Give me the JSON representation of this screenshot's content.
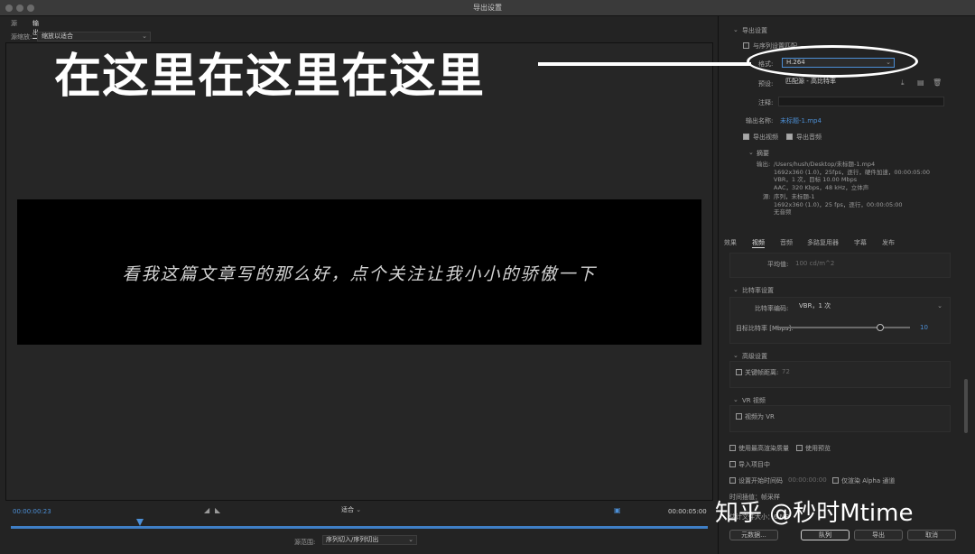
{
  "window": {
    "title": "导出设置"
  },
  "tabs": {
    "source": "源",
    "output": "输出"
  },
  "source_scale": {
    "label": "源缩放:",
    "value": "缩放以适合"
  },
  "overlay": {
    "text": "在这里在这里在这里"
  },
  "video": {
    "subtitle": "看我这篇文章写的那么好，点个关注让我小小的骄傲一下"
  },
  "timeline": {
    "start": "00:00:00:23",
    "end": "00:00:05:00",
    "fit": "适合",
    "range_label": "源范围:",
    "range_value": "序列切入/序列切出"
  },
  "export_settings": {
    "section": "导出设置",
    "match_seq": "与序列设置匹配",
    "format_label": "格式:",
    "format_value": "H.264",
    "preset_label": "预设:",
    "preset_value": "匹配源 - 高比特率",
    "comment_label": "注释:",
    "output_name_label": "输出名称:",
    "output_name_value": "未标题-1.mp4",
    "export_video": "导出视频",
    "export_audio": "导出音频",
    "summary_title": "摘要",
    "output_label": "输出:",
    "output_lines": [
      "/Users/hush/Desktop/未标题-1.mp4",
      "1692x360 (1.0)，25fps，逐行，硬件加速，00:00:05:00",
      "VBR，1 次，目标 10.00 Mbps",
      "AAC，320 Kbps，48 kHz，立体声"
    ],
    "source_label": "源:",
    "source_lines": [
      "序列，未标题-1",
      "1692x360 (1.0)，25 fps，逐行，00:00:05:00",
      "无音频"
    ]
  },
  "section_tabs": [
    "效果",
    "视频",
    "音频",
    "多路复用器",
    "字幕",
    "发布"
  ],
  "video_settings": {
    "avg_label": "平均值:",
    "avg_value": "100 cd/m^2",
    "bitrate_section": "比特率设置",
    "bitrate_encoding_label": "比特率编码:",
    "bitrate_encoding_value": "VBR，1 次",
    "target_label": "目标比特率 [Mbps]:",
    "target_value": "10",
    "advanced_section": "高级设置",
    "keyframe_label": "关键帧距离:",
    "keyframe_value": "72",
    "vr_section": "VR 视频",
    "vr_label": "视频为 VR"
  },
  "bottom_options": {
    "max_render": "使用最高渲染质量",
    "use_preview": "使用预览",
    "import_project": "导入项目中",
    "set_start": "设置开始时间码",
    "start_tc": "00:00:00:00",
    "render_alpha": "仅渲染 Alpha 通道",
    "time_interp": "时间插值：帧采样",
    "size_est": "估计文件大小：6 MB"
  },
  "buttons": {
    "metadata": "元数据...",
    "queue": "队列",
    "export": "导出",
    "cancel": "取消"
  },
  "watermark": {
    "text": "知乎 @秒时Mtime"
  }
}
